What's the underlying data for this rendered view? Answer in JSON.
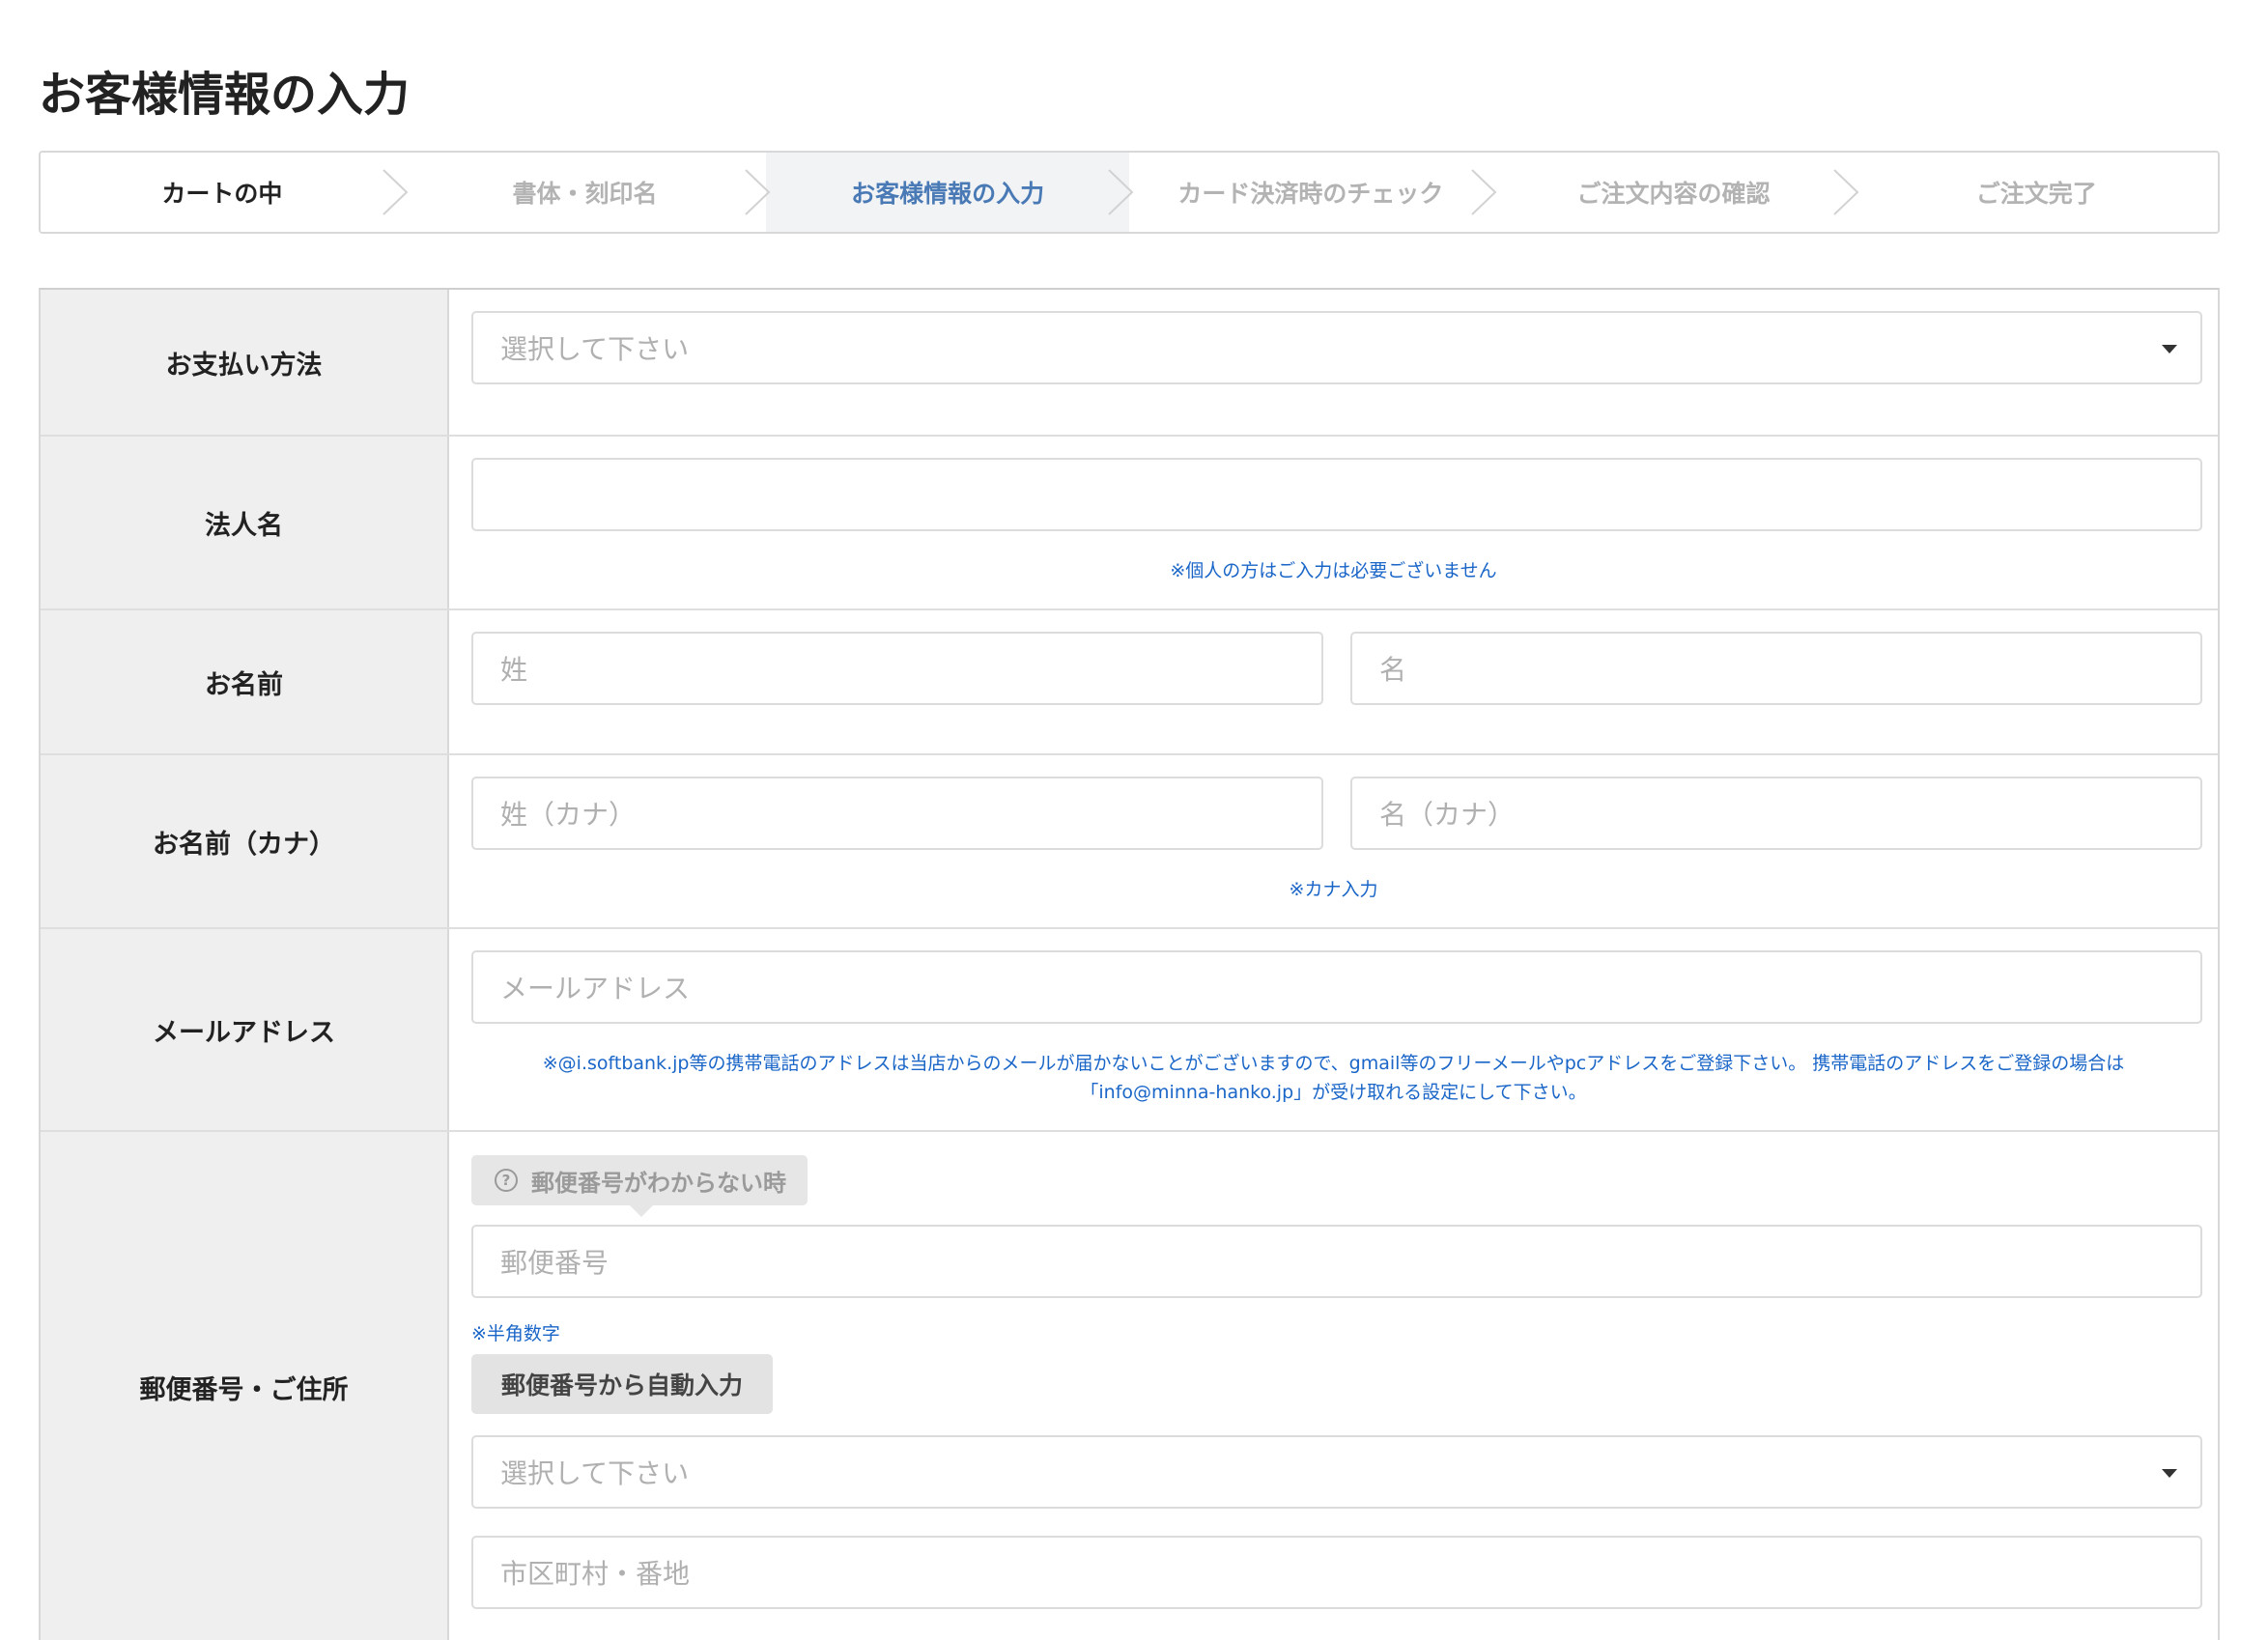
{
  "page": {
    "title": "お客様情報の入力"
  },
  "steps": [
    {
      "label": "カートの中",
      "state": "done"
    },
    {
      "label": "書体・刻印名",
      "state": "upcoming"
    },
    {
      "label": "お客様情報の入力",
      "state": "current"
    },
    {
      "label": "カード決済時のチェック",
      "state": "upcoming"
    },
    {
      "label": "ご注文内容の確認",
      "state": "upcoming"
    },
    {
      "label": "ご注文完了",
      "state": "upcoming"
    }
  ],
  "form": {
    "payment": {
      "label": "お支払い方法",
      "placeholder": "選択して下さい"
    },
    "company": {
      "label": "法人名",
      "value": "",
      "note": "※個人の方はご入力は必要ございません"
    },
    "name": {
      "label": "お名前",
      "last_placeholder": "姓",
      "first_placeholder": "名"
    },
    "kana": {
      "label": "お名前（カナ）",
      "last_placeholder": "姓（カナ）",
      "first_placeholder": "名（カナ）",
      "note": "※カナ入力"
    },
    "email": {
      "label": "メールアドレス",
      "placeholder": "メールアドレス",
      "note_line1": "※@i.softbank.jp等の携帯電話のアドレスは当店からのメールが届かないことがございますので、gmail等のフリーメールやpcアドレスをご登録下さい。 携帯電話のアドレスをご登録の場合は",
      "note_line2": "「info@minna-hanko.jp」が受け取れる設定にして下さい。"
    },
    "address": {
      "label": "郵便番号・ご住所",
      "help_label": "郵便番号がわからない時",
      "help_icon": "question-circle-icon",
      "zip_placeholder": "郵便番号",
      "zip_note": "※半角数字",
      "autofill_label": "郵便番号から自動入力",
      "prefecture_placeholder": "選択して下さい",
      "city_placeholder": "市区町村・番地"
    }
  },
  "colors": {
    "current_step": "#4a7ab5",
    "note_text": "#1a66c8",
    "label_bg": "#efefef",
    "border": "#d8d8d8"
  }
}
